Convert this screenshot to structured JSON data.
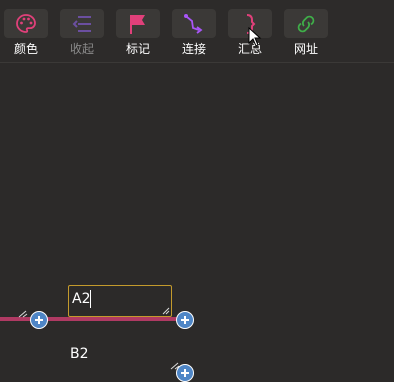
{
  "toolbar": {
    "buttons": [
      {
        "label": "颜色",
        "icon": "palette-icon",
        "color": "#e0407a",
        "disabled": false
      },
      {
        "label": "收起",
        "icon": "collapse-icon",
        "color": "#6b4fa0",
        "disabled": true
      },
      {
        "label": "标记",
        "icon": "flag-icon",
        "color": "#e0407a",
        "disabled": false
      },
      {
        "label": "连接",
        "icon": "connect-icon",
        "color": "#a855f7",
        "disabled": false
      },
      {
        "label": "汇总",
        "icon": "summary-icon",
        "color": "#e0407a",
        "disabled": false
      },
      {
        "label": "网址",
        "icon": "link-icon",
        "color": "#3fae49",
        "disabled": false
      }
    ]
  },
  "canvas": {
    "node_a2": {
      "text": "A2"
    },
    "node_b2": {
      "text": "B2"
    },
    "edge_color": "#b03a63",
    "focus_border_color": "#c49a2c"
  }
}
